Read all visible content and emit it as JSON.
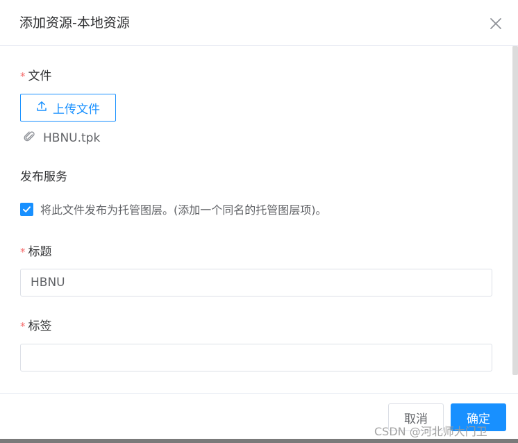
{
  "dialog": {
    "title": "添加资源-本地资源",
    "close_icon": "close-icon"
  },
  "form": {
    "file": {
      "label": "文件",
      "required_mark": "*",
      "upload_button_label": "上传文件",
      "upload_icon": "upload-icon",
      "uploaded_file": "HBNU.tpk",
      "attachment_icon": "paperclip-icon"
    },
    "publish": {
      "label": "发布服务",
      "checkbox_checked": true,
      "checkbox_label": "将此文件发布为托管图层。(添加一个同名的托管图层项)。"
    },
    "title": {
      "label": "标题",
      "required_mark": "*",
      "value": "HBNU"
    },
    "tags": {
      "label": "标签",
      "required_mark": "*",
      "value": ""
    }
  },
  "footer": {
    "cancel_label": "取消",
    "ok_label": "确定"
  },
  "watermark": "CSDN @河北师大门卫",
  "colors": {
    "primary": "#1890ff",
    "required": "#f56c6c",
    "border": "#dcdfe6"
  }
}
